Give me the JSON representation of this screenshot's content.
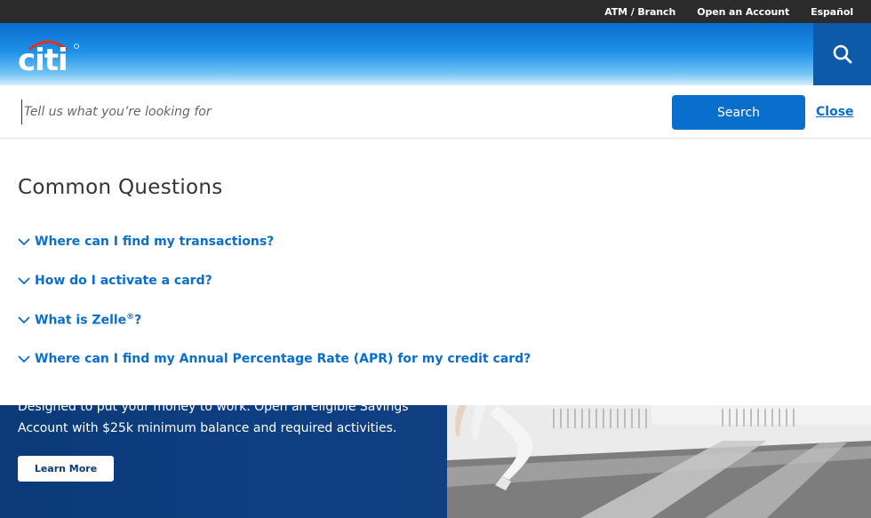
{
  "utility_nav": {
    "items": [
      {
        "label": "ATM / Branch"
      },
      {
        "label": "Open an Account"
      },
      {
        "label": "Español"
      }
    ]
  },
  "header": {
    "logo_text": "citi",
    "search_icon": "search-icon"
  },
  "search": {
    "placeholder": "Tell us what you’re looking for",
    "button_label": "Search",
    "close_label": "Close"
  },
  "common_questions": {
    "title": "Common Questions",
    "items": [
      {
        "text": "Where can I find my transactions?"
      },
      {
        "text": "How do I activate a card?"
      },
      {
        "text": "What is Zelle",
        "sup": "®",
        "suffix": "?"
      },
      {
        "text": "Where can I find my Annual Percentage Rate (APR) for my credit card?"
      }
    ]
  },
  "promo": {
    "text": "Designed to put your money to work. Open an eligible Savings Account with $25k minimum balance and required activities.",
    "button_label": "Learn More"
  },
  "colors": {
    "brand_blue": "#0a6ecd",
    "dark_navy": "#0c3a78",
    "utility_bar": "#2b2b2b"
  }
}
